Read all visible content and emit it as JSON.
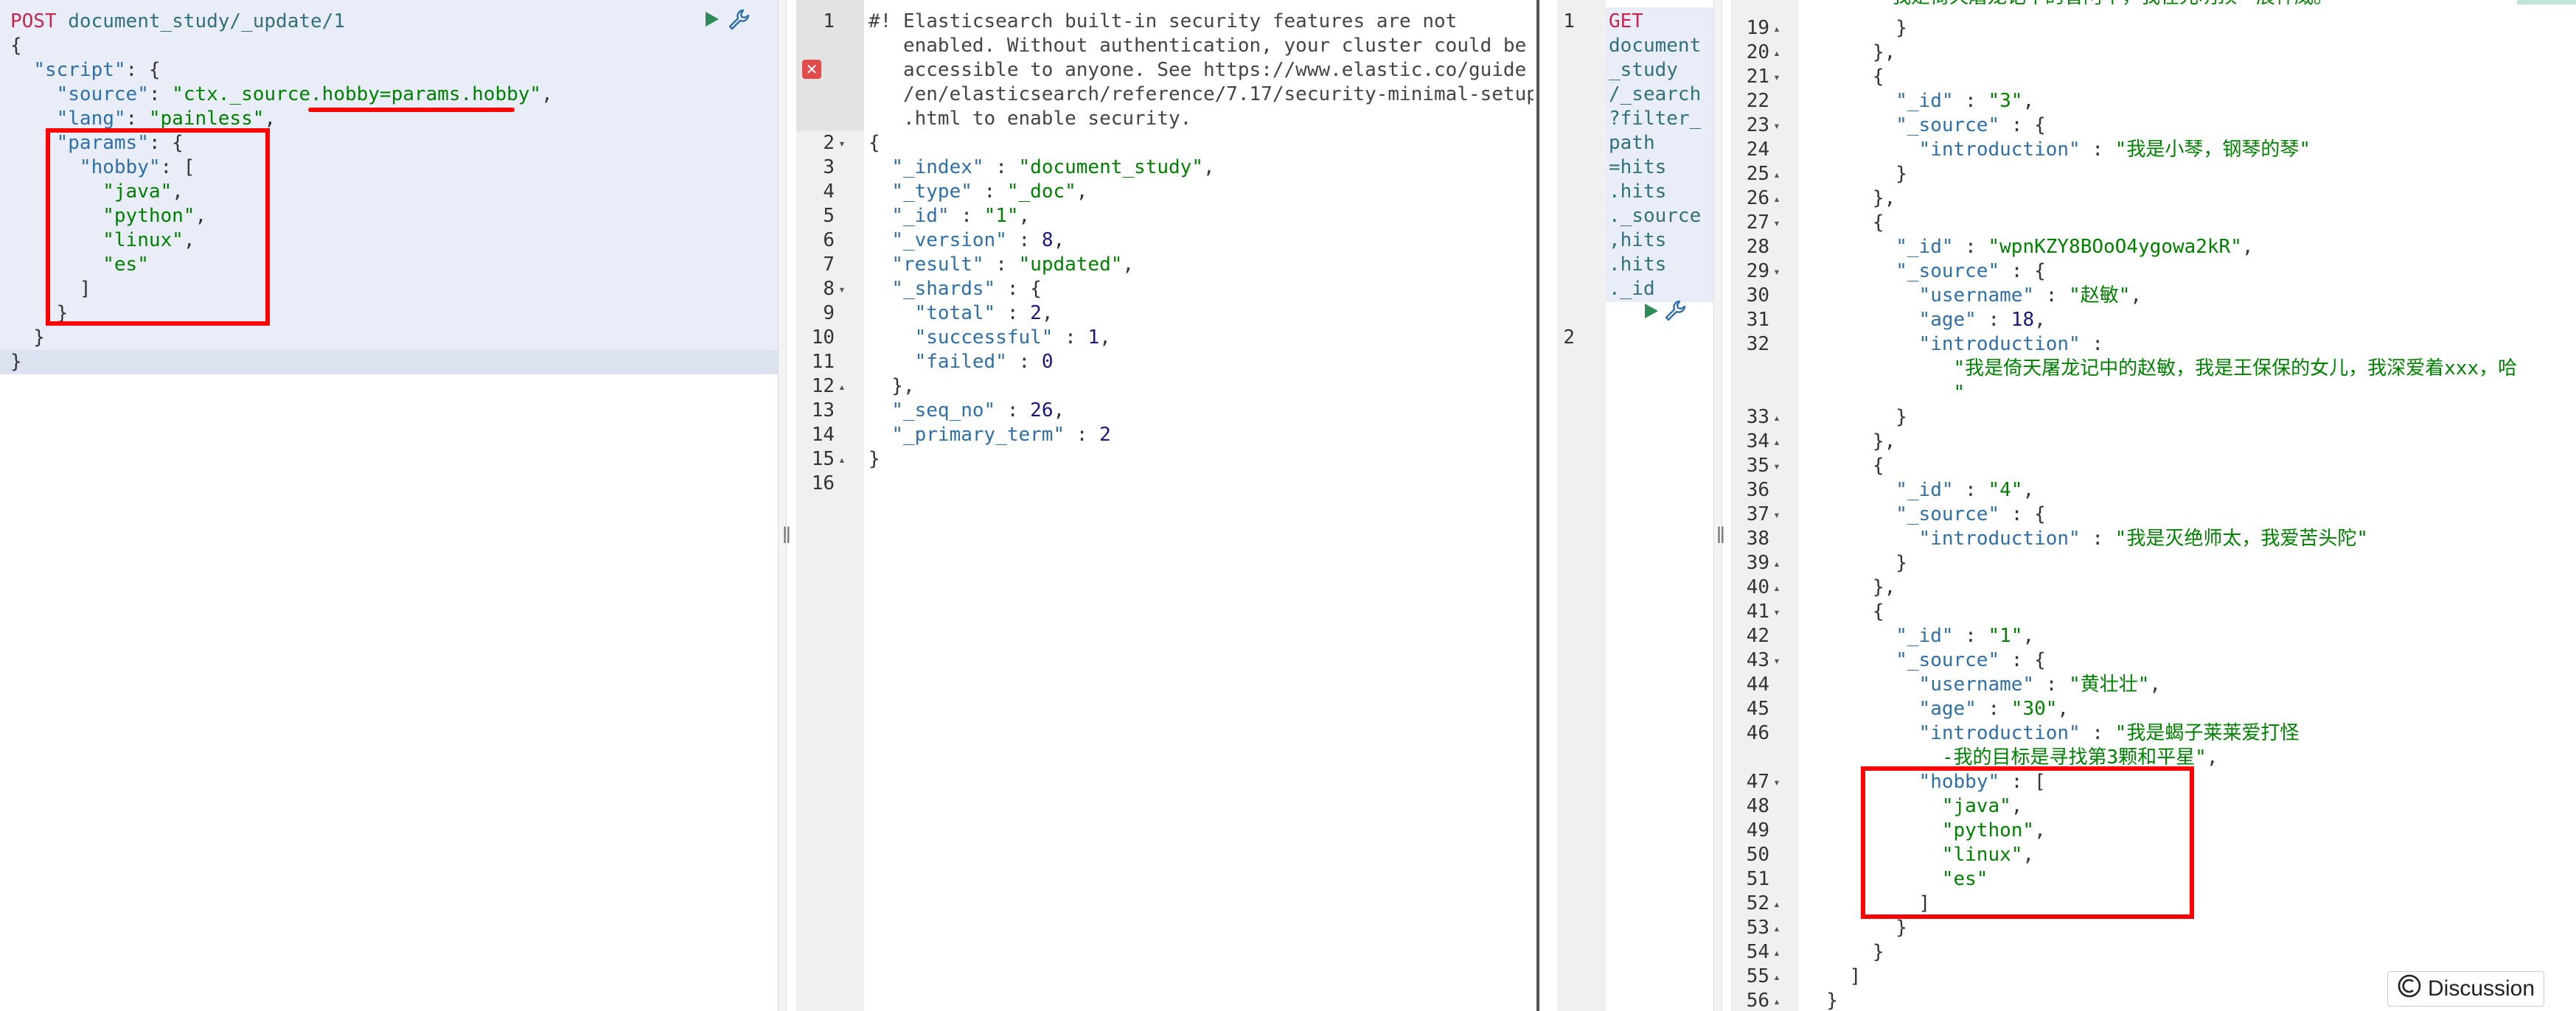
{
  "request_left": {
    "lines": [
      [
        {
          "t": "POST",
          "c": "red"
        },
        {
          "t": " document_study/_update/1",
          "c": "teal"
        }
      ],
      [
        {
          "t": "{",
          "c": ""
        }
      ],
      [
        {
          "t": "  ",
          "c": ""
        },
        {
          "t": "\"script\"",
          "c": "key"
        },
        {
          "t": ": {",
          "c": ""
        }
      ],
      [
        {
          "t": "    ",
          "c": ""
        },
        {
          "t": "\"source\"",
          "c": "key"
        },
        {
          "t": ": ",
          "c": ""
        },
        {
          "t": "\"ctx._source.hobby=params.hobby\"",
          "c": "str"
        },
        {
          "t": ",",
          "c": ""
        }
      ],
      [
        {
          "t": "    ",
          "c": ""
        },
        {
          "t": "\"lang\"",
          "c": "key"
        },
        {
          "t": ": ",
          "c": ""
        },
        {
          "t": "\"painless\"",
          "c": "str"
        },
        {
          "t": ",",
          "c": ""
        }
      ],
      [
        {
          "t": "    ",
          "c": ""
        },
        {
          "t": "\"params\"",
          "c": "key"
        },
        {
          "t": ": {",
          "c": ""
        }
      ],
      [
        {
          "t": "      ",
          "c": ""
        },
        {
          "t": "\"hobby\"",
          "c": "key"
        },
        {
          "t": ": [",
          "c": ""
        }
      ],
      [
        {
          "t": "        ",
          "c": ""
        },
        {
          "t": "\"java\"",
          "c": "str"
        },
        {
          "t": ",",
          "c": ""
        }
      ],
      [
        {
          "t": "        ",
          "c": ""
        },
        {
          "t": "\"python\"",
          "c": "str"
        },
        {
          "t": ",",
          "c": ""
        }
      ],
      [
        {
          "t": "        ",
          "c": ""
        },
        {
          "t": "\"linux\"",
          "c": "str"
        },
        {
          "t": ",",
          "c": ""
        }
      ],
      [
        {
          "t": "        ",
          "c": ""
        },
        {
          "t": "\"es\"",
          "c": "str"
        }
      ],
      [
        {
          "t": "      ]",
          "c": ""
        }
      ],
      [
        {
          "t": "    }",
          "c": ""
        }
      ],
      [
        {
          "t": "  }",
          "c": ""
        }
      ],
      [
        {
          "t": "}",
          "c": ""
        }
      ]
    ]
  },
  "response_middle": {
    "line_numbers": [
      "1",
      "",
      "",
      "",
      "",
      "2",
      "3",
      "4",
      "5",
      "6",
      "7",
      "8",
      "9",
      "10",
      "11",
      "12",
      "13",
      "14",
      "15",
      "16"
    ],
    "fold_markers": {
      "2": "▾",
      "8": "▾",
      "12": "▴",
      "15": "▴"
    },
    "lines": [
      [
        {
          "t": "#! Elasticsearch built-in security features are not",
          "c": "com"
        }
      ],
      [
        {
          "t": "   enabled. Without authentication, your cluster could be",
          "c": "com"
        }
      ],
      [
        {
          "t": "   accessible to anyone. See https://www.elastic.co/guide",
          "c": "com"
        }
      ],
      [
        {
          "t": "   /en/elasticsearch/reference/7.17/security-minimal-setup",
          "c": "com"
        }
      ],
      [
        {
          "t": "   .html to enable security.",
          "c": "com"
        }
      ],
      [
        {
          "t": "{",
          "c": ""
        }
      ],
      [
        {
          "t": "  ",
          "c": ""
        },
        {
          "t": "\"_index\"",
          "c": "key"
        },
        {
          "t": " : ",
          "c": ""
        },
        {
          "t": "\"document_study\"",
          "c": "str"
        },
        {
          "t": ",",
          "c": ""
        }
      ],
      [
        {
          "t": "  ",
          "c": ""
        },
        {
          "t": "\"_type\"",
          "c": "key"
        },
        {
          "t": " : ",
          "c": ""
        },
        {
          "t": "\"_doc\"",
          "c": "str"
        },
        {
          "t": ",",
          "c": ""
        }
      ],
      [
        {
          "t": "  ",
          "c": ""
        },
        {
          "t": "\"_id\"",
          "c": "key"
        },
        {
          "t": " : ",
          "c": ""
        },
        {
          "t": "\"1\"",
          "c": "str"
        },
        {
          "t": ",",
          "c": ""
        }
      ],
      [
        {
          "t": "  ",
          "c": ""
        },
        {
          "t": "\"_version\"",
          "c": "key"
        },
        {
          "t": " : ",
          "c": ""
        },
        {
          "t": "8",
          "c": "num"
        },
        {
          "t": ",",
          "c": ""
        }
      ],
      [
        {
          "t": "  ",
          "c": ""
        },
        {
          "t": "\"result\"",
          "c": "key"
        },
        {
          "t": " : ",
          "c": ""
        },
        {
          "t": "\"updated\"",
          "c": "str"
        },
        {
          "t": ",",
          "c": ""
        }
      ],
      [
        {
          "t": "  ",
          "c": ""
        },
        {
          "t": "\"_shards\"",
          "c": "key"
        },
        {
          "t": " : {",
          "c": ""
        }
      ],
      [
        {
          "t": "    ",
          "c": ""
        },
        {
          "t": "\"total\"",
          "c": "key"
        },
        {
          "t": " : ",
          "c": ""
        },
        {
          "t": "2",
          "c": "num"
        },
        {
          "t": ",",
          "c": ""
        }
      ],
      [
        {
          "t": "    ",
          "c": ""
        },
        {
          "t": "\"successful\"",
          "c": "key"
        },
        {
          "t": " : ",
          "c": ""
        },
        {
          "t": "1",
          "c": "num"
        },
        {
          "t": ",",
          "c": ""
        }
      ],
      [
        {
          "t": "    ",
          "c": ""
        },
        {
          "t": "\"failed\"",
          "c": "key"
        },
        {
          "t": " : ",
          "c": ""
        },
        {
          "t": "0",
          "c": "num"
        }
      ],
      [
        {
          "t": "  },",
          "c": ""
        }
      ],
      [
        {
          "t": "  ",
          "c": ""
        },
        {
          "t": "\"_seq_no\"",
          "c": "key"
        },
        {
          "t": " : ",
          "c": ""
        },
        {
          "t": "26",
          "c": "num"
        },
        {
          "t": ",",
          "c": ""
        }
      ],
      [
        {
          "t": "  ",
          "c": ""
        },
        {
          "t": "\"_primary_term\"",
          "c": "key"
        },
        {
          "t": " : ",
          "c": ""
        },
        {
          "t": "2",
          "c": "num"
        }
      ],
      [
        {
          "t": "}",
          "c": ""
        }
      ],
      [
        {
          "t": "",
          "c": ""
        }
      ]
    ]
  },
  "request_right": {
    "line_numbers": [
      "1",
      "",
      "",
      "",
      "",
      "",
      "",
      "",
      "",
      "",
      "",
      "",
      "",
      "2"
    ],
    "lines": [
      [
        {
          "t": "GET",
          "c": "red"
        }
      ],
      [
        {
          "t": "document",
          "c": "teal"
        }
      ],
      [
        {
          "t": "_study",
          "c": "teal"
        }
      ],
      [
        {
          "t": "/_search",
          "c": "teal"
        }
      ],
      [
        {
          "t": "?filter_",
          "c": "teal"
        }
      ],
      [
        {
          "t": "path",
          "c": "teal"
        }
      ],
      [
        {
          "t": "=hits",
          "c": "teal"
        }
      ],
      [
        {
          "t": ".hits",
          "c": "teal"
        }
      ],
      [
        {
          "t": "._source",
          "c": "teal"
        }
      ],
      [
        {
          "t": ",hits",
          "c": "teal"
        }
      ],
      [
        {
          "t": ".hits",
          "c": "teal"
        }
      ],
      [
        {
          "t": "._id",
          "c": "teal"
        }
      ],
      [
        {
          "t": "",
          "c": ""
        }
      ]
    ]
  },
  "response_right": {
    "top_partial_text": "我是倚天屠龙记中的曾阿牛，我在光明顶一展神威。",
    "line_numbers": [
      "19",
      "20",
      "21",
      "22",
      "23",
      "24",
      "25",
      "26",
      "27",
      "28",
      "29",
      "30",
      "31",
      "32",
      "",
      "",
      "33",
      "34",
      "35",
      "36",
      "37",
      "38",
      "39",
      "40",
      "41",
      "42",
      "43",
      "44",
      "45",
      "46",
      "",
      "47",
      "48",
      "49",
      "50",
      "51",
      "52",
      "53",
      "54",
      "55",
      "56"
    ],
    "fold_markers": {
      "19": "▴",
      "20": "▴",
      "21": "▾",
      "23": "▾",
      "25": "▴",
      "26": "▴",
      "27": "▾",
      "29": "▾",
      "33": "▴",
      "34": "▴",
      "35": "▾",
      "37": "▾",
      "39": "▴",
      "40": "▴",
      "41": "▾",
      "43": "▾",
      "47": "▾",
      "52": "▴",
      "53": "▴",
      "54": "▴",
      "55": "▴",
      "56": "▴"
    },
    "lines": [
      [
        {
          "t": "        }",
          "c": ""
        }
      ],
      [
        {
          "t": "      },",
          "c": ""
        }
      ],
      [
        {
          "t": "      {",
          "c": ""
        }
      ],
      [
        {
          "t": "        ",
          "c": ""
        },
        {
          "t": "\"_id\"",
          "c": "key"
        },
        {
          "t": " : ",
          "c": ""
        },
        {
          "t": "\"3\"",
          "c": "str"
        },
        {
          "t": ",",
          "c": ""
        }
      ],
      [
        {
          "t": "        ",
          "c": ""
        },
        {
          "t": "\"_source\"",
          "c": "key"
        },
        {
          "t": " : {",
          "c": ""
        }
      ],
      [
        {
          "t": "          ",
          "c": ""
        },
        {
          "t": "\"introduction\"",
          "c": "key"
        },
        {
          "t": " : ",
          "c": ""
        },
        {
          "t": "\"我是小琴，钢琴的琴\"",
          "c": "str"
        }
      ],
      [
        {
          "t": "        }",
          "c": ""
        }
      ],
      [
        {
          "t": "      },",
          "c": ""
        }
      ],
      [
        {
          "t": "      {",
          "c": ""
        }
      ],
      [
        {
          "t": "        ",
          "c": ""
        },
        {
          "t": "\"_id\"",
          "c": "key"
        },
        {
          "t": " : ",
          "c": ""
        },
        {
          "t": "\"wpnKZY8BOoO4ygowa2kR\"",
          "c": "str"
        },
        {
          "t": ",",
          "c": ""
        }
      ],
      [
        {
          "t": "        ",
          "c": ""
        },
        {
          "t": "\"_source\"",
          "c": "key"
        },
        {
          "t": " : {",
          "c": ""
        }
      ],
      [
        {
          "t": "          ",
          "c": ""
        },
        {
          "t": "\"username\"",
          "c": "key"
        },
        {
          "t": " : ",
          "c": ""
        },
        {
          "t": "\"赵敏\"",
          "c": "str"
        },
        {
          "t": ",",
          "c": ""
        }
      ],
      [
        {
          "t": "          ",
          "c": ""
        },
        {
          "t": "\"age\"",
          "c": "key"
        },
        {
          "t": " : ",
          "c": ""
        },
        {
          "t": "18",
          "c": "num"
        },
        {
          "t": ",",
          "c": ""
        }
      ],
      [
        {
          "t": "          ",
          "c": ""
        },
        {
          "t": "\"introduction\"",
          "c": "key"
        },
        {
          "t": " :",
          "c": ""
        }
      ],
      [
        {
          "t": "             ",
          "c": ""
        },
        {
          "t": "\"我是倚天屠龙记中的赵敏，我是王保保的女儿，我深爱着xxx，哈",
          "c": "str"
        }
      ],
      [
        {
          "t": "             ",
          "c": ""
        },
        {
          "t": "\"",
          "c": "str"
        }
      ],
      [
        {
          "t": "        }",
          "c": ""
        }
      ],
      [
        {
          "t": "      },",
          "c": ""
        }
      ],
      [
        {
          "t": "      {",
          "c": ""
        }
      ],
      [
        {
          "t": "        ",
          "c": ""
        },
        {
          "t": "\"_id\"",
          "c": "key"
        },
        {
          "t": " : ",
          "c": ""
        },
        {
          "t": "\"4\"",
          "c": "str"
        },
        {
          "t": ",",
          "c": ""
        }
      ],
      [
        {
          "t": "        ",
          "c": ""
        },
        {
          "t": "\"_source\"",
          "c": "key"
        },
        {
          "t": " : {",
          "c": ""
        }
      ],
      [
        {
          "t": "          ",
          "c": ""
        },
        {
          "t": "\"introduction\"",
          "c": "key"
        },
        {
          "t": " : ",
          "c": ""
        },
        {
          "t": "\"我是灭绝师太，我爱苦头陀\"",
          "c": "str"
        }
      ],
      [
        {
          "t": "        }",
          "c": ""
        }
      ],
      [
        {
          "t": "      },",
          "c": ""
        }
      ],
      [
        {
          "t": "      {",
          "c": ""
        }
      ],
      [
        {
          "t": "        ",
          "c": ""
        },
        {
          "t": "\"_id\"",
          "c": "key"
        },
        {
          "t": " : ",
          "c": ""
        },
        {
          "t": "\"1\"",
          "c": "str"
        },
        {
          "t": ",",
          "c": ""
        }
      ],
      [
        {
          "t": "        ",
          "c": ""
        },
        {
          "t": "\"_source\"",
          "c": "key"
        },
        {
          "t": " : {",
          "c": ""
        }
      ],
      [
        {
          "t": "          ",
          "c": ""
        },
        {
          "t": "\"username\"",
          "c": "key"
        },
        {
          "t": " : ",
          "c": ""
        },
        {
          "t": "\"黄壮壮\"",
          "c": "str"
        },
        {
          "t": ",",
          "c": ""
        }
      ],
      [
        {
          "t": "          ",
          "c": ""
        },
        {
          "t": "\"age\"",
          "c": "key"
        },
        {
          "t": " : ",
          "c": ""
        },
        {
          "t": "\"30\"",
          "c": "str"
        },
        {
          "t": ",",
          "c": ""
        }
      ],
      [
        {
          "t": "          ",
          "c": ""
        },
        {
          "t": "\"introduction\"",
          "c": "key"
        },
        {
          "t": " : ",
          "c": ""
        },
        {
          "t": "\"我是蝎子莱莱爱打怪",
          "c": "str"
        }
      ],
      [
        {
          "t": "            ",
          "c": ""
        },
        {
          "t": "-我的目标是寻找第3颗和平星\"",
          "c": "str"
        },
        {
          "t": ",",
          "c": ""
        }
      ],
      [
        {
          "t": "          ",
          "c": ""
        },
        {
          "t": "\"hobby\"",
          "c": "key"
        },
        {
          "t": " : [",
          "c": ""
        }
      ],
      [
        {
          "t": "            ",
          "c": ""
        },
        {
          "t": "\"java\"",
          "c": "str"
        },
        {
          "t": ",",
          "c": ""
        }
      ],
      [
        {
          "t": "            ",
          "c": ""
        },
        {
          "t": "\"python\"",
          "c": "str"
        },
        {
          "t": ",",
          "c": ""
        }
      ],
      [
        {
          "t": "            ",
          "c": ""
        },
        {
          "t": "\"linux\"",
          "c": "str"
        },
        {
          "t": ",",
          "c": ""
        }
      ],
      [
        {
          "t": "            ",
          "c": ""
        },
        {
          "t": "\"es\"",
          "c": "str"
        }
      ],
      [
        {
          "t": "          ]",
          "c": ""
        }
      ],
      [
        {
          "t": "        }",
          "c": ""
        }
      ],
      [
        {
          "t": "      }",
          "c": ""
        }
      ],
      [
        {
          "t": "    ]",
          "c": ""
        }
      ],
      [
        {
          "t": "  }",
          "c": ""
        }
      ]
    ]
  },
  "discussion_badge": {
    "label": "Discussion"
  },
  "colors": {
    "accent_red": "#ff0000",
    "post_method": "#c7254e",
    "string": "#008000",
    "key": "#2f6fa7",
    "run_button": "#2e8b57"
  },
  "icons": [
    "run-icon",
    "wrench-icon",
    "error-icon",
    "discussion-icon"
  ]
}
